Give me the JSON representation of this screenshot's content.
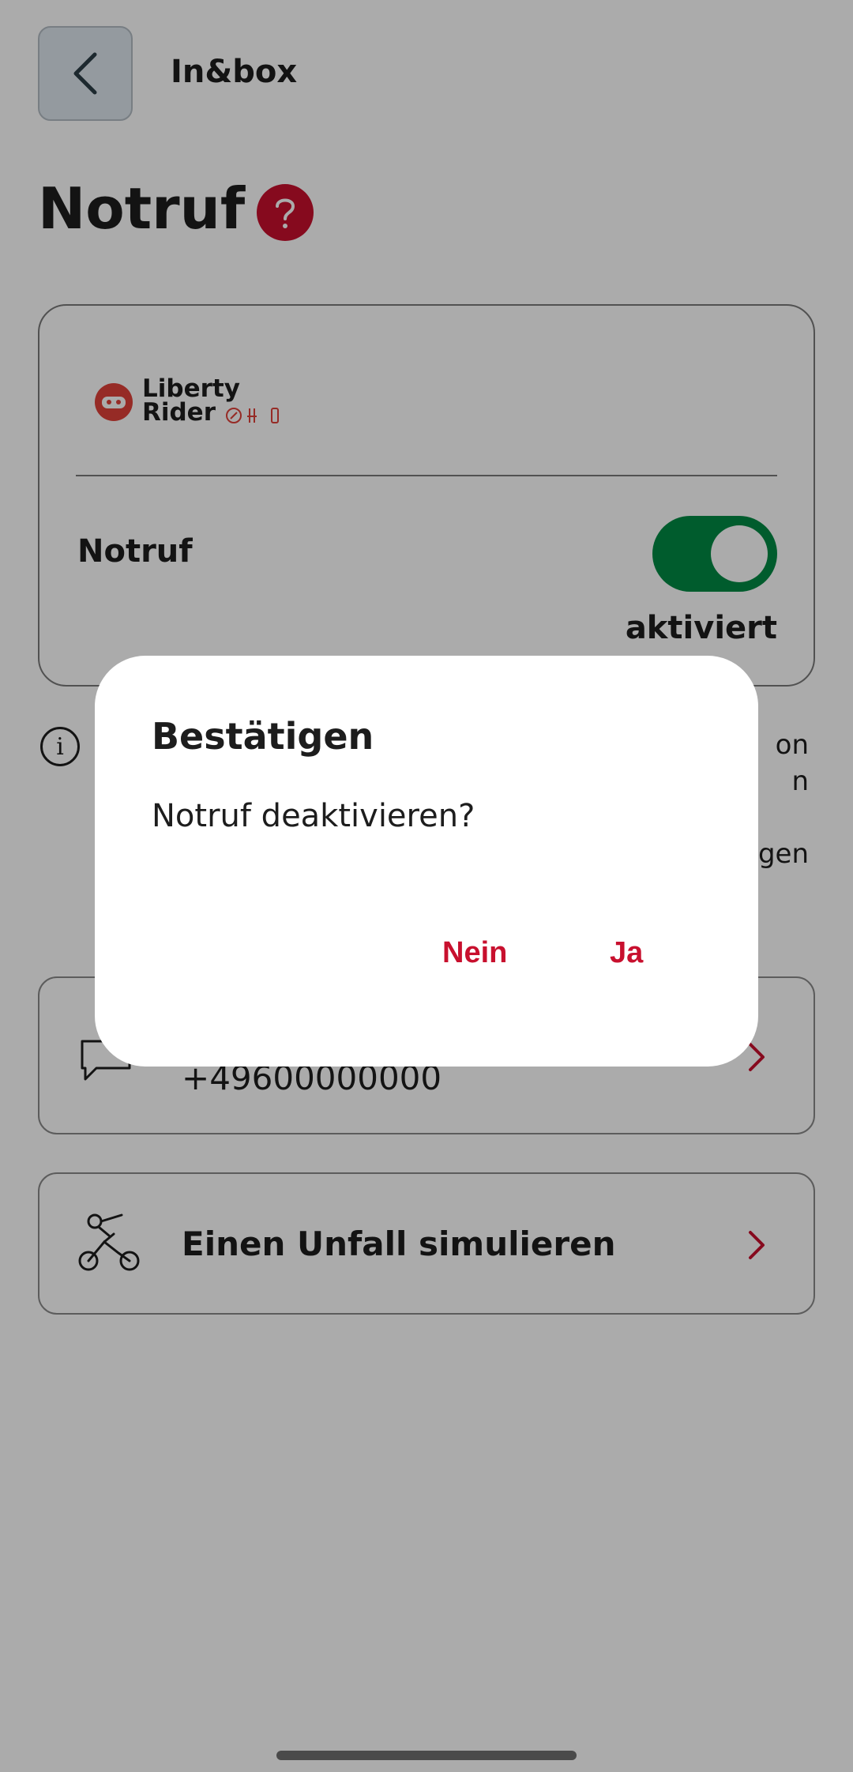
{
  "header": {
    "back_icon": "chevron-left-icon",
    "title": "In&box"
  },
  "page": {
    "title": "Notruf",
    "help_icon": "question-mark-icon"
  },
  "emergency_card": {
    "logo_text_line1": "Liberty",
    "logo_text_line2": "Rider",
    "label": "Notruf",
    "toggle_on": true,
    "status": "aktiviert",
    "accent_color": "#008a44"
  },
  "info": {
    "icon": "info-icon",
    "text": "on\nn\n\ngen"
  },
  "contact_row": {
    "icon": "chat-bubble-icon",
    "number": "+49600000000"
  },
  "simulate_row": {
    "icon": "motorcycle-crash-icon",
    "title": "Einen Unfall simulieren"
  },
  "dialog": {
    "title": "Bestätigen",
    "message": "Notruf deaktivieren?",
    "no_label": "Nein",
    "yes_label": "Ja",
    "button_color": "#c8102e"
  }
}
